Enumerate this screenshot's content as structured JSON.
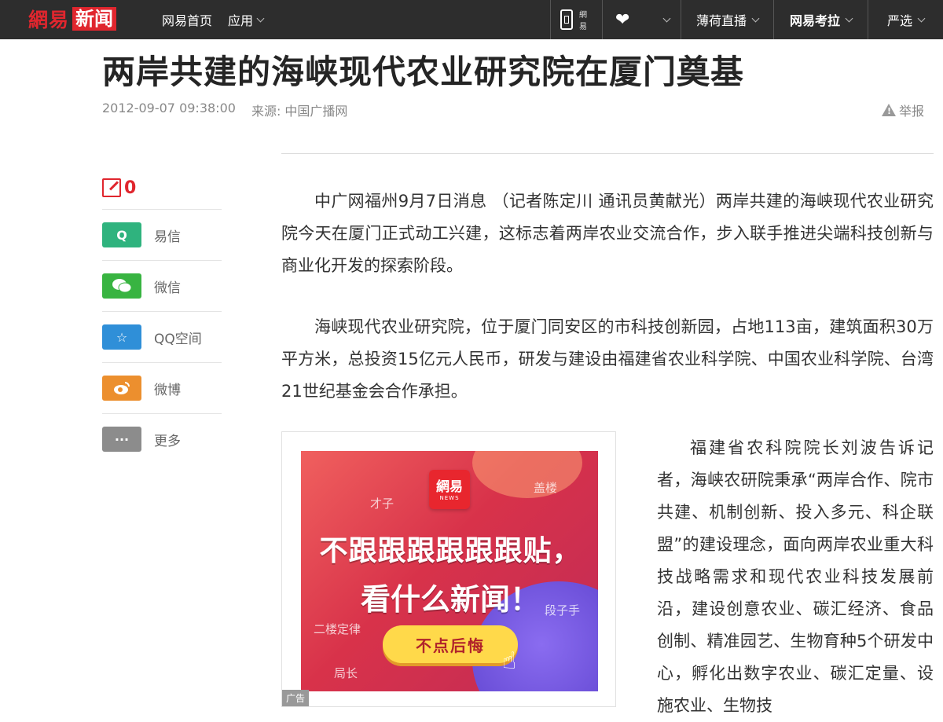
{
  "topbar": {
    "brand": "網易",
    "brand_suffix": "新闻",
    "nav": [
      {
        "label": "网易首页"
      },
      {
        "label": "应用"
      }
    ],
    "right": {
      "app_label": "網易",
      "live": "薄荷直播",
      "kaola": "网易考拉",
      "yanxuan": "严选"
    }
  },
  "article": {
    "title": "两岸共建的海峡现代农业研究院在厦门奠基",
    "date": "2012-09-07 09:38:00",
    "source": "来源: 中国广播网",
    "report": "举报",
    "paragraphs": [
      "中广网福州9月7日消息 （记者陈定川 通讯员黄献光）两岸共建的海峡现代农业研究院今天在厦门正式动工兴建，这标志着两岸农业交流合作，步入联手推进尖端科技创新与商业化开发的探索阶段。",
      "海峡现代农业研究院，位于厦门同安区的市科技创新园，占地113亩，建筑面积30万平方米，总投资15亿元人民币，研发与建设由福建省农业科学院、中国农业科学院、台湾21世纪基金会合作承担。",
      "福建省农科院院长刘波告诉记者，海峡农研院秉承“两岸合作、院市共建、机制创新、投入多元、科企联盟”的建设理念，面向两岸农业重大科技战略需求和现代农业科技发展前沿，建设创意农业、碳汇经济、食品创制、精准园艺、生物育种5个研发中心，孵化出数字农业、碳汇定量、设施农业、生物技"
    ]
  },
  "share": {
    "comment_count": "0",
    "items": [
      {
        "label": "易信",
        "color": "#2fb37e",
        "icon": "yixin-icon"
      },
      {
        "label": "微信",
        "color": "#38b441",
        "icon": "wechat-icon"
      },
      {
        "label": "QQ空间",
        "color": "#2f8fd8",
        "icon": "qzone-icon"
      },
      {
        "label": "微博",
        "color": "#ec8f2e",
        "icon": "weibo-icon"
      },
      {
        "label": "更多",
        "color": "#8c8c8c",
        "icon": "more-icon"
      }
    ]
  },
  "ad": {
    "logo": "網易",
    "logo_sub": "NEWS",
    "line1": "不跟跟跟跟跟跟贴，",
    "line2": "看什么新闻！",
    "button": "不点后悔",
    "tags": [
      "才子",
      "盖楼",
      "段子手",
      "二楼定律",
      "局长"
    ],
    "label": "广告"
  }
}
